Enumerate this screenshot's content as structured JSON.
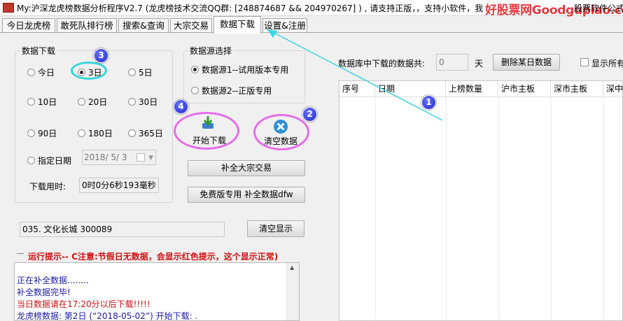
{
  "window": {
    "title": "My:沪深龙虎榜数据分析程序V2.7 (龙虎榜技术交流QQ群: [248874687 && 204970267] ) , 请支持正版，，支持小软件，我",
    "watermark": "好股票网Goodgupiao.com",
    "right_label": "股票软件公式"
  },
  "tabs": [
    "今日龙虎榜",
    "敢死队排行榜",
    "搜索&查询",
    "大宗交易",
    "数据下载",
    "设置&注册"
  ],
  "download_group": {
    "label": "数据下载",
    "options": [
      "今日",
      "3日",
      "5日",
      "10日",
      "20日",
      "30日",
      "90日",
      "180日",
      "365日",
      "指定日期"
    ],
    "selected": "3日",
    "date_value": "2018/ 5/ 3",
    "elapsed_label": "下载用时:",
    "elapsed_value": "0时0分6秒193毫秒"
  },
  "source_group": {
    "label": "数据源选择",
    "options": [
      "数据源1--试用版本专用",
      "数据源2--正版专用"
    ],
    "selected": "数据源1--试用版本专用"
  },
  "buttons": {
    "start_download": "开始下载",
    "clear_data": "清空数据",
    "fill_block_trade": "补全大宗交易",
    "fill_free": "免费版专用 补全数据dfw",
    "clear_display": "清空显示",
    "delete_day": "删除某日数据"
  },
  "db_info": {
    "label": "数据库中下载的数据共:",
    "count": "0",
    "unit": "天",
    "show_all_label": "显示所有"
  },
  "stock_field": "035. 文化长城   300089",
  "run_hint": "运行提示-- C注意:节假日无数据，会显示红色提示，这个显示正常)",
  "grid_columns": [
    "序号",
    "日期",
    "上榜数量",
    "沪市主板",
    "深市主板",
    "深中"
  ],
  "log_lines": [
    {
      "text": "正在补全数据........",
      "color": "#1a1aa6"
    },
    {
      "text": "补全数据完毕!",
      "color": "#1a1aa6"
    },
    {
      "text": "当日数据请在17:20分以后下载!!!!!",
      "color": "#d01010"
    },
    {
      "text": "龙虎榜数据: 第2日 (“2018-05-02”) 开始下载: .",
      "color": "#1a1aa6"
    }
  ],
  "annotations": [
    "1",
    "2",
    "3",
    "4"
  ],
  "colors": {
    "accent_ellipse_cyan": "#37d6dc",
    "accent_ellipse_pink": "#e46ee8",
    "badge_blue": "#1c25c8",
    "watermark_red": "#e8383d"
  }
}
